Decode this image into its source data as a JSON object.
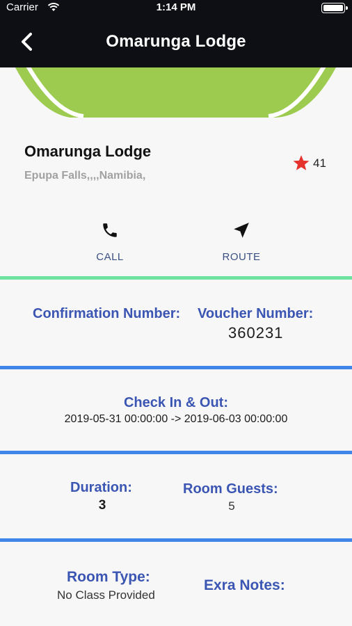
{
  "status_bar": {
    "carrier": "Carrier",
    "time": "1:14 PM"
  },
  "header": {
    "title": "Omarunga Lodge"
  },
  "lodge": {
    "name": "Omarunga Lodge",
    "address": "Epupa Falls,,,,Namibia,",
    "rating": "41"
  },
  "actions": {
    "call": "CALL",
    "route": "ROUTE"
  },
  "booking": {
    "confirmation_label": "Confirmation Number:",
    "voucher_label": "Voucher Number:",
    "voucher_value": "360231",
    "checkin_label": "Check In & Out:",
    "checkin_value": "2019-05-31 00:00:00 -> 2019-06-03 00:00:00",
    "duration_label": "Duration:",
    "duration_value": "3",
    "guests_label": "Room Guests:",
    "guests_value": "5",
    "room_type_label": "Room Type:",
    "room_type_value": "No Class Provided",
    "notes_label": "Exra Notes:"
  },
  "colors": {
    "header_bg": "#0d0f14",
    "banner_green": "#9ccb4f",
    "heading_blue": "#3b55b3",
    "separator_blue": "#3f86e8",
    "separator_green": "#6fe3a0",
    "star_red": "#e5322d"
  },
  "icons": {
    "back": "chevron-left-icon",
    "call": "phone-icon",
    "route": "navigation-arrow-icon",
    "rating": "star-icon"
  }
}
